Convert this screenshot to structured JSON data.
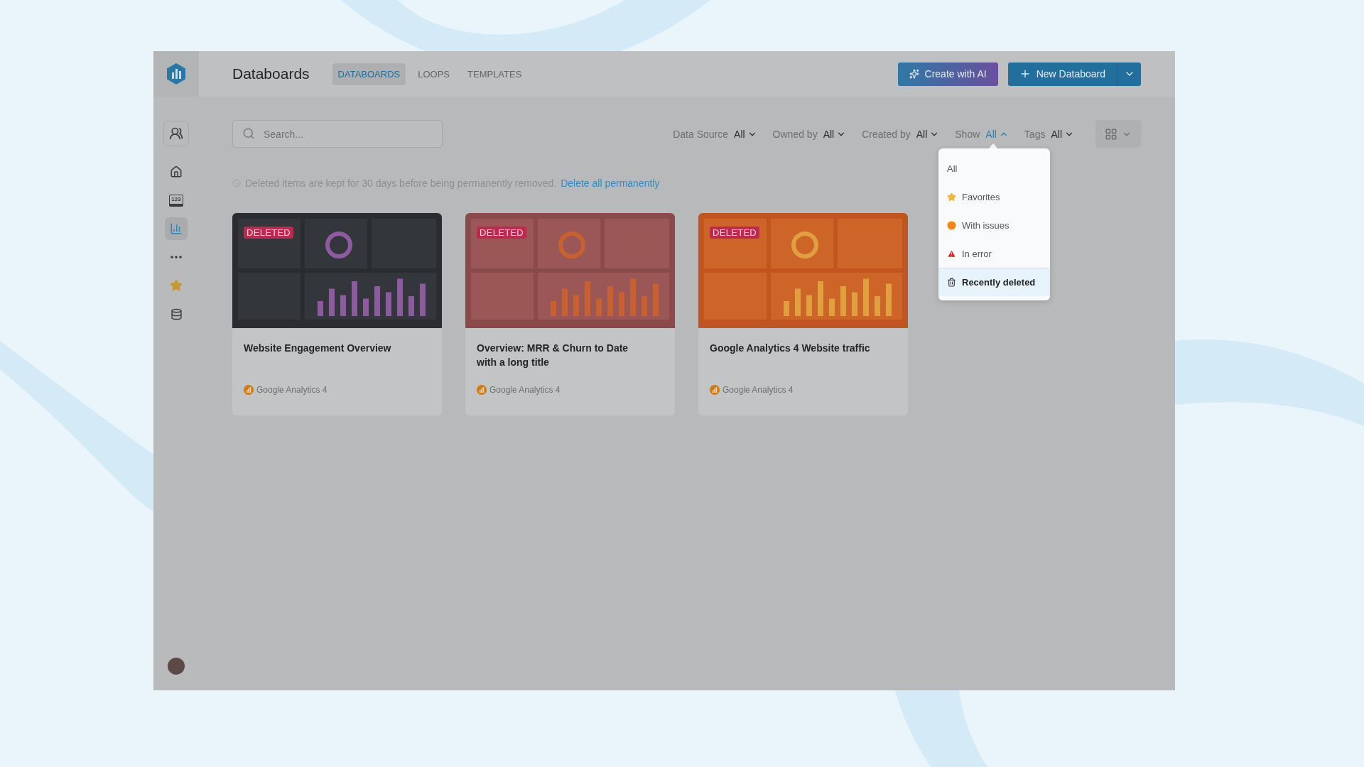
{
  "header": {
    "title": "Databoards",
    "tabs": [
      {
        "label": "DATABOARDS",
        "selected": true
      },
      {
        "label": "LOOPS",
        "selected": false
      },
      {
        "label": "TEMPLATES",
        "selected": false
      }
    ],
    "actions": [
      {
        "label": "Create with AI",
        "kind": "ai"
      },
      {
        "label": "New Databoard",
        "kind": "primary"
      }
    ]
  },
  "sidebar": {
    "items": [
      {
        "kind": "account",
        "selected": false
      },
      {
        "kind": "home",
        "selected": false
      },
      {
        "kind": "numbers",
        "glyph": "123",
        "selected": false
      },
      {
        "kind": "databoards",
        "selected": true
      },
      {
        "kind": "more",
        "selected": false
      },
      {
        "kind": "favorites",
        "selected": false
      },
      {
        "kind": "data",
        "selected": false
      }
    ]
  },
  "search": {
    "placeholder": "Search..."
  },
  "filters": [
    {
      "label": "Data Source",
      "value": "All",
      "expanded": false
    },
    {
      "label": "Owned by",
      "value": "All",
      "expanded": false
    },
    {
      "label": "Created by",
      "value": "All",
      "expanded": false
    },
    {
      "label": "Show",
      "value": "All",
      "expanded": true
    },
    {
      "label": "Tags",
      "value": "All",
      "expanded": false
    }
  ],
  "notice": {
    "text": "Deleted items are kept for 30 days before being permanently removed.",
    "link": "Delete all permanently"
  },
  "cards": [
    {
      "title": "Website Engagement Overview",
      "badge": "DELETED",
      "source": "Google Analytics 4",
      "kind": "dark"
    },
    {
      "title": "Overview: MRR & Churn to Date with a long title",
      "badge": "DELETED",
      "source": "Google Analytics 4",
      "kind": "red"
    },
    {
      "title": "Google Analytics 4 Website traffic",
      "badge": "DELETED",
      "source": "Google Analytics 4",
      "kind": "orange"
    }
  ],
  "show_menu": {
    "items": [
      {
        "label": "All",
        "kind": "all",
        "selected": false
      },
      {
        "label": "Favorites",
        "kind": "star",
        "selected": false
      },
      {
        "label": "With issues",
        "kind": "issues",
        "selected": false
      },
      {
        "label": "In error",
        "kind": "error",
        "selected": false
      },
      {
        "label": "Recently deleted",
        "kind": "deleted",
        "selected": true
      }
    ]
  }
}
